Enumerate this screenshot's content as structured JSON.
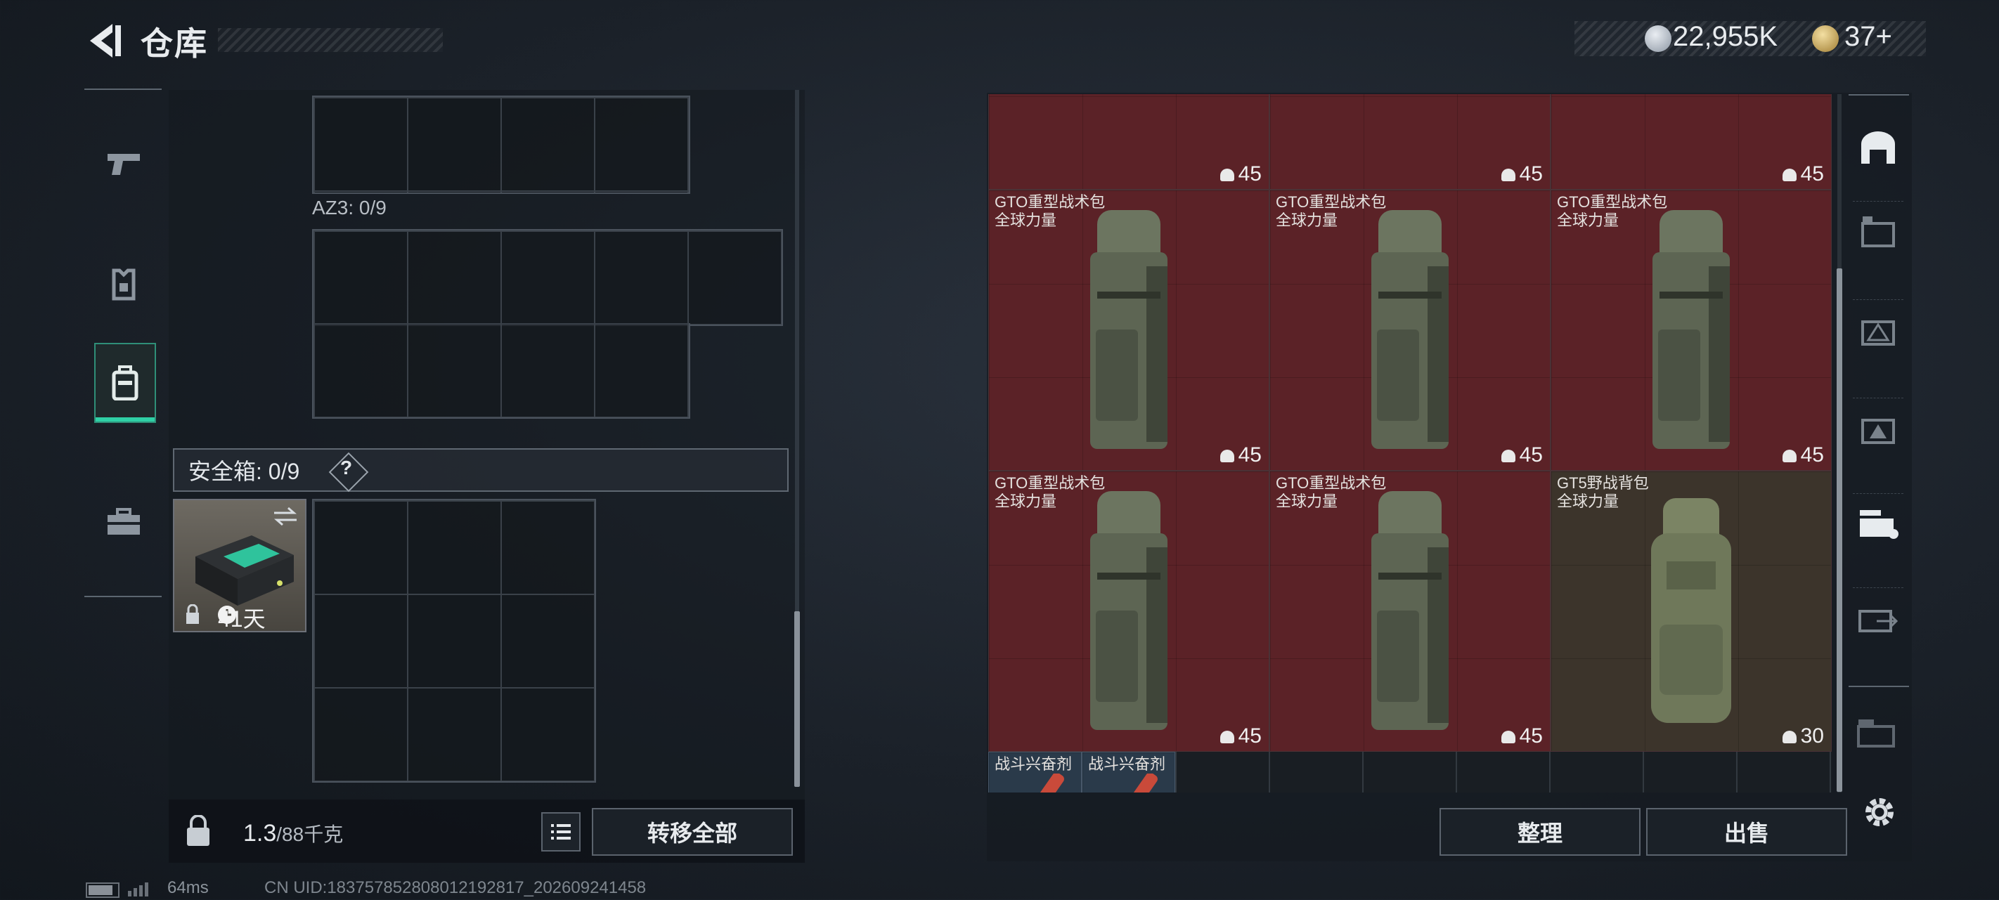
{
  "header": {
    "title": "仓库",
    "currency_value": "22,955K",
    "tickets_value": "37+"
  },
  "left_panel": {
    "az_label": "AZ3: 0/9",
    "safe_box_label": "安全箱: 0/9",
    "safe_help": "?",
    "safe_item_days": "41天",
    "weight_value": "1.3",
    "weight_unit": "/88千克",
    "transfer_all_label": "转移全部"
  },
  "warehouse": {
    "items": [
      {
        "name": "GTO重型战术包",
        "sub": "全球力量",
        "count": "45"
      },
      {
        "name": "GTO重型战术包",
        "sub": "全球力量",
        "count": "45"
      },
      {
        "name": "GTO重型战术包",
        "sub": "全球力量",
        "count": "45"
      },
      {
        "name": "GTO重型战术包",
        "sub": "全球力量",
        "count": "45"
      },
      {
        "name": "GTO重型战术包",
        "sub": "全球力量",
        "count": "45"
      },
      {
        "name": "GT5野战背包",
        "sub": "全球力量",
        "count": "30"
      },
      {
        "name": "战斗兴奋剂"
      },
      {
        "name": "战斗兴奋剂"
      }
    ],
    "top_row_counts": [
      "45",
      "45",
      "45"
    ],
    "sort_label": "整理",
    "sell_label": "出售"
  },
  "status": {
    "ping": "64ms",
    "uid": "CN UID:18375785280801219281​7_202609241458"
  },
  "colors": {
    "accent_green": "#2fd0a6",
    "item_red": "#5b2227",
    "item_tan": "#3c342b"
  }
}
